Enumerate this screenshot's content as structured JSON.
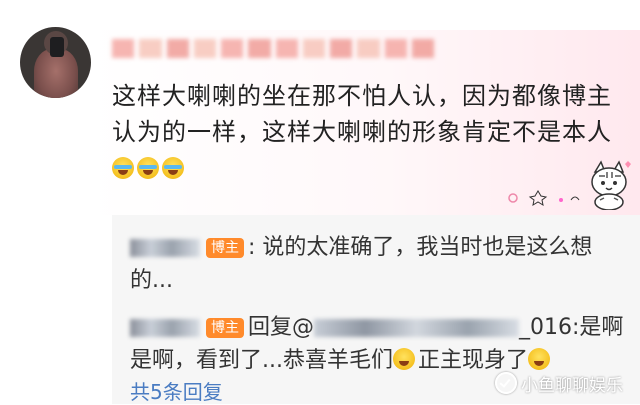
{
  "comment": {
    "username": "",
    "body": "这样大喇喇的坐在那不怕人认，因为都像博主认为的一样，这样大喇喇的形象肯定不是本人",
    "emoji": [
      "laugh-cry-emoji",
      "laugh-cry-emoji",
      "laugh-cry-emoji"
    ]
  },
  "replies": [
    {
      "author_badge": "博主",
      "text": ": 说的太准确了，我当时也是这么想的..."
    },
    {
      "author_badge": "博主",
      "reply_prefix": "回复@",
      "mention_suffix": "_016",
      "text_a": ":是啊是啊，看到了...恭喜羊毛们",
      "text_b": "正主现身了"
    }
  ],
  "more_replies_link": "共5条回复",
  "watermark": "小鱼聊聊娱乐",
  "colors": {
    "badge": "#ff8a2b",
    "link": "#4a7cc2",
    "reply_bg": "#f6f6f6"
  }
}
